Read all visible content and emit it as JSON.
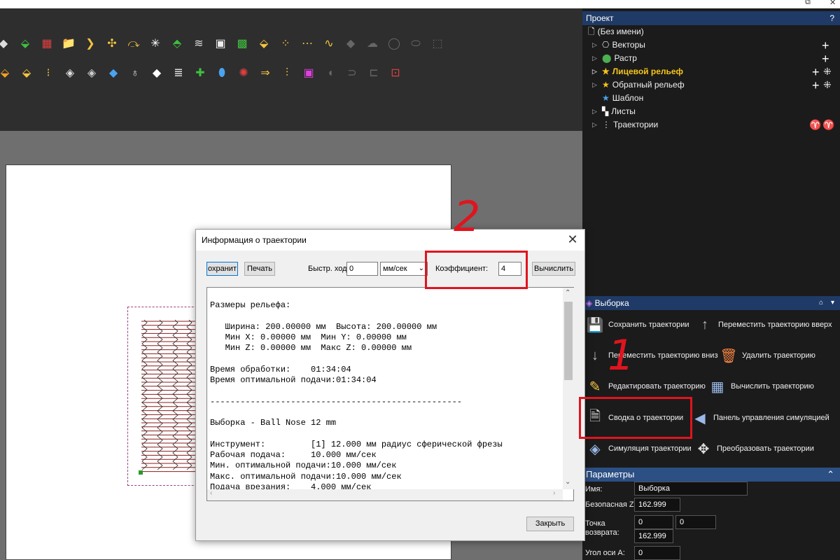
{
  "project_panel": {
    "title": "Проект",
    "help": "?",
    "items": [
      {
        "label": "(Без имени)"
      },
      {
        "label": "Векторы"
      },
      {
        "label": "Растр"
      },
      {
        "label": "Лицевой рельеф"
      },
      {
        "label": "Обратный рельеф"
      },
      {
        "label": "Шаблон"
      },
      {
        "label": "Листы"
      },
      {
        "label": "Траектории"
      }
    ]
  },
  "selection_panel": {
    "title": "Выборка",
    "actions": [
      {
        "label": "Сохранить траектории"
      },
      {
        "label": "Переместить траекторию вверх"
      },
      {
        "label": "Переместить траекторию вниз"
      },
      {
        "label": "Удалить траекторию"
      },
      {
        "label": "Редактировать траекторию"
      },
      {
        "label": "Вычислить траекторию"
      },
      {
        "label": "Сводка о траектории"
      },
      {
        "label": "Панель управления симуляцией"
      },
      {
        "label": "Симуляция траектории"
      },
      {
        "label": "Преобразовать траектории"
      }
    ]
  },
  "params_panel": {
    "title": "Параметры",
    "name_label": "Имя:",
    "name_value": "Выборка",
    "safe_z_label": "Безопасная Z:",
    "safe_z_value": "162.999",
    "return_label": "Точка возврата:",
    "return_x": "0",
    "return_y": "0",
    "return_z": "162.999",
    "angle_label": "Угол оси A:",
    "angle_value": "0"
  },
  "dialog": {
    "title": "Информация о траектории",
    "save_button": "охранит",
    "print_button": "Печать",
    "rapid_label": "Быстр. ход",
    "rapid_value": "0",
    "units_value": "мм/сек",
    "coef_label": "Коэффициент:",
    "coef_value": "4",
    "calc_button": "Вычислить",
    "close_button": "Закрыть",
    "text": "Размеры рельефа:\n\n   Ширина: 200.00000 мм  Высота: 200.00000 мм\n   Мин X: 0.00000 мм  Мин Y: 0.00000 мм\n   Мин Z: 0.00000 мм  Макс Z: 0.00000 мм\n\nВремя обработки:    01:34:04\nВремя оптимальной подачи:01:34:04\n\n--------------------------------------------------\n\nВыборка - Ball Nose 12 mm\n\nИнструмент:         [1] 12.000 мм радиус сферической фрезы\nРабочая подача:     10.000 мм/сек\nМин. оптимальной подачи:10.000 мм/сек\nМакс. оптимальной подачи:10.000 мм/сек\nПодача врезания:    4.000 мм/сек"
  },
  "annotations": {
    "mark_one": "1",
    "mark_two": "2"
  },
  "colors": {
    "annotation_red": "#e0141e",
    "panel_header_blue": "#1f3a66",
    "toolbar_bg": "#2e2e2e",
    "workspace_bg": "#6f6f6f"
  }
}
